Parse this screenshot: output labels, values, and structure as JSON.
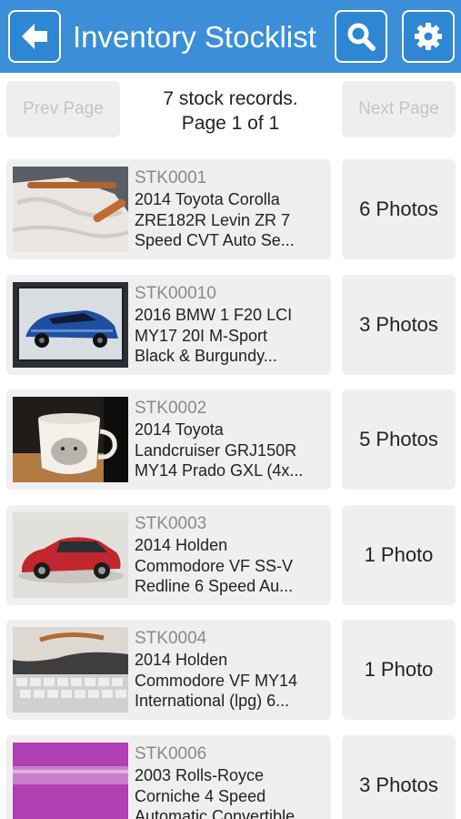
{
  "header": {
    "title": "Inventory Stocklist",
    "back_icon": "arrow-left-icon",
    "search_icon": "search-icon",
    "settings_icon": "gear-icon",
    "accent": "#3a8fd8"
  },
  "pager": {
    "prev_label": "Prev Page",
    "next_label": "Next Page",
    "record_count": "7 stock records.",
    "page_info": "Page 1 of 1"
  },
  "records": [
    {
      "id": "STK0001",
      "lines": [
        "2014 Toyota Corolla",
        "ZRE182R Levin ZR 7",
        "Speed CVT Auto Se..."
      ],
      "photos": "6 Photos"
    },
    {
      "id": "STK00010",
      "lines": [
        "2016 BMW 1 F20 LCI",
        "MY17 20I M-Sport",
        "Black & Burgundy..."
      ],
      "photos": "3 Photos"
    },
    {
      "id": "STK0002",
      "lines": [
        "2014 Toyota",
        "Landcruiser GRJ150R",
        "MY14 Prado GXL (4x..."
      ],
      "photos": "5 Photos"
    },
    {
      "id": "STK0003",
      "lines": [
        "2014 Holden",
        "Commodore VF SS-V",
        "Redline 6 Speed Au..."
      ],
      "photos": "1 Photo"
    },
    {
      "id": "STK0004",
      "lines": [
        "2014 Holden",
        "Commodore VF MY14",
        "International (lpg) 6..."
      ],
      "photos": "1 Photo"
    },
    {
      "id": "STK0006",
      "lines": [
        "2003 Rolls-Royce",
        "Corniche 4 Speed",
        "Automatic Convertible"
      ],
      "photos": "3 Photos"
    }
  ]
}
